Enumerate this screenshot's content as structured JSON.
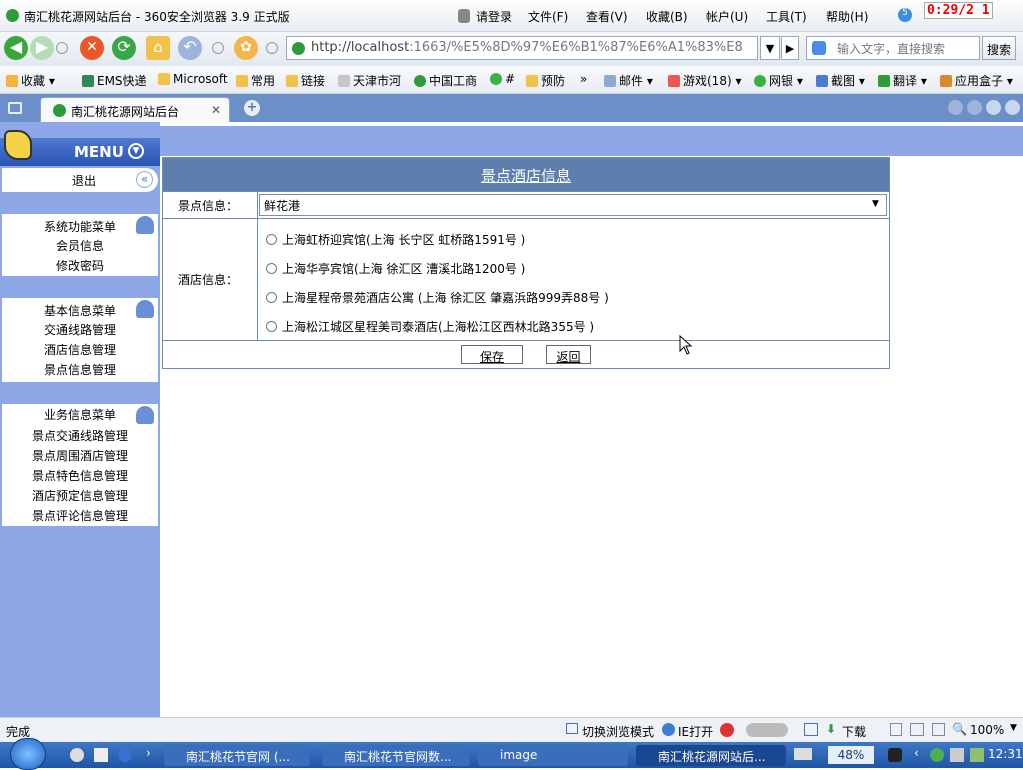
{
  "window": {
    "title": "南汇桃花源网站后台 - 360安全浏览器 3.9 正式版",
    "timer": "0:29/2 1"
  },
  "menubar": {
    "login": "请登录",
    "file": "文件(F)",
    "view": "查看(V)",
    "favorites": "收藏(B)",
    "account": "帐户(U)",
    "tools": "工具(T)",
    "help": "帮助(H)",
    "badge": "5"
  },
  "address": {
    "url_host": "http://localhost",
    "url_rest": ":1663/%E5%8D%97%E6%B1%87%E6%A1%83%E8"
  },
  "search": {
    "placeholder": "输入文字，直接搜索",
    "button": "搜索"
  },
  "favorites": [
    "收藏",
    "EMS快递",
    "Microsoft",
    "常用",
    "链接",
    "天津市河",
    "中国工商",
    "#",
    "预防",
    "»",
    "邮件",
    "游戏(18)",
    "网银",
    "截图",
    "翻译",
    "应用盒子"
  ],
  "tab": {
    "label": "南汇桃花源网站后台",
    "close": "✕",
    "new": "+"
  },
  "sidebar": {
    "menu_title": "MENU",
    "logout": "退出",
    "groups": [
      {
        "title": "系统功能菜单",
        "items": [
          "会员信息",
          "修改密码"
        ]
      },
      {
        "title": "基本信息菜单",
        "items": [
          "交通线路管理",
          "酒店信息管理",
          "景点信息管理"
        ]
      },
      {
        "title": "业务信息菜单",
        "items": [
          "景点交通线路管理",
          "景点周围酒店管理",
          "景点特色信息管理",
          "酒店预定信息管理",
          "景点评论信息管理"
        ]
      }
    ]
  },
  "form": {
    "title": "景点酒店信息",
    "spot_label": "景点信息：",
    "spot_value": "鲜花港",
    "hotel_label": "酒店信息：",
    "hotels": [
      "上海虹桥迎宾馆(上海 长宁区 虹桥路1591号 )",
      "上海华亭宾馆(上海 徐汇区 漕溪北路1200号 )",
      "上海星程帝景苑酒店公寓 (上海 徐汇区 肇嘉浜路999弄88号 )",
      "上海松江城区星程美司泰酒店(上海松江区西林北路355号 )"
    ],
    "save": "保存",
    "back": "返回"
  },
  "statusbar": {
    "status": "完成",
    "switch_mode": "切换浏览模式",
    "ie_open": "IE打开",
    "download": "下载",
    "zoom": "100%"
  },
  "taskbar": {
    "tasks": [
      "南汇桃花节官网 (...",
      "南汇桃花节官网数...",
      "image",
      "南汇桃花源网站后..."
    ],
    "battery": "48%",
    "clock": "12:31"
  },
  "colors": {
    "sidebar": "#8ea7e6",
    "form_header": "#5d7fae",
    "taskbar": "#1f55a6"
  }
}
